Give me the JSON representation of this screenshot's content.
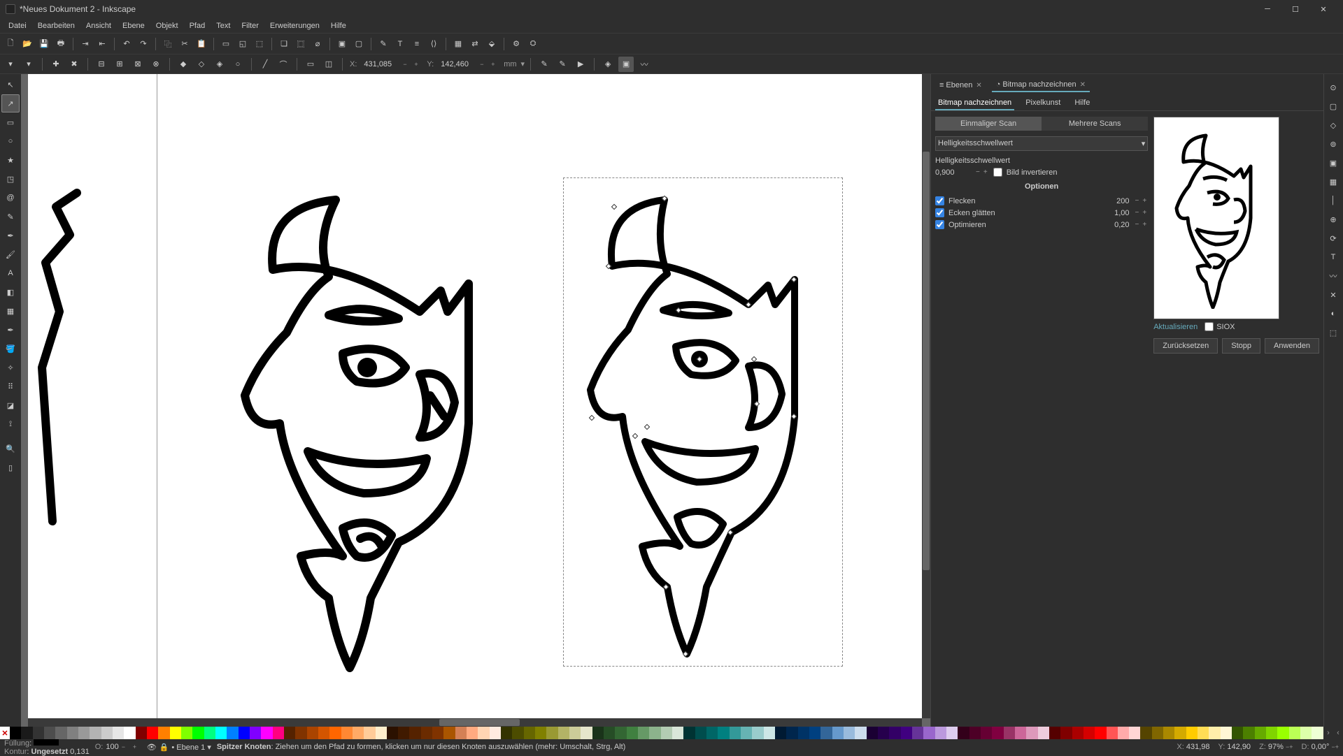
{
  "title": "*Neues Dokument 2 - Inkscape",
  "menus": [
    "Datei",
    "Bearbeiten",
    "Ansicht",
    "Ebene",
    "Objekt",
    "Pfad",
    "Text",
    "Filter",
    "Erweiterungen",
    "Hilfe"
  ],
  "coords": {
    "xlabel": "X:",
    "xval": "431,085",
    "ylabel": "Y:",
    "yval": "142,460",
    "unit": "mm"
  },
  "dialog": {
    "tab_layers": "Ebenen",
    "tab_trace": "Bitmap nachzeichnen",
    "sub_trace": "Bitmap nachzeichnen",
    "sub_pixel": "Pixelkunst",
    "sub_help": "Hilfe",
    "single": "Einmaliger Scan",
    "multi": "Mehrere Scans",
    "method": "Helligkeitsschwellwert",
    "method_label": "Helligkeitsschwellwert",
    "method_val": "0,900",
    "invert": "Bild invertieren",
    "options": "Optionen",
    "speckles": "Flecken",
    "speckles_val": "200",
    "smooth": "Ecken glätten",
    "smooth_val": "1,00",
    "optimize": "Optimieren",
    "optimize_val": "0,20",
    "update": "Aktualisieren",
    "siox": "SIOX",
    "reset": "Zurücksetzen",
    "stop": "Stopp",
    "apply": "Anwenden"
  },
  "status": {
    "fill": "Füllung",
    "stroke": "Kontur",
    "stroke_val": "Ungesetzt",
    "stroke_w": "0,131",
    "opacity_label": "O:",
    "opacity": "100",
    "layer": "Ebene 1",
    "hint_b": "Spitzer Knoten",
    "hint": ": Ziehen um den Pfad zu formen, klicken um nur diesen Knoten auszuwählen (mehr: Umschalt, Strg, Alt)",
    "xlabel": "X:",
    "x": "431,98",
    "ylabel": "Y:",
    "y": "142,90",
    "zlabel": "Z:",
    "z": "97%",
    "dlabel": "D:",
    "d": "0,00°"
  },
  "palette": [
    "#000",
    "#1a1a1a",
    "#333",
    "#4d4d4d",
    "#666",
    "#808080",
    "#999",
    "#b3b3b3",
    "#ccc",
    "#e6e6e6",
    "#fff",
    "#800000",
    "#f00",
    "#ff8000",
    "#ff0",
    "#80ff00",
    "#0f0",
    "#00ff80",
    "#0ff",
    "#0080ff",
    "#00f",
    "#8000ff",
    "#f0f",
    "#ff0080",
    "#552200",
    "#803300",
    "#aa4400",
    "#d45500",
    "#ff6600",
    "#ff8833",
    "#ffaa66",
    "#ffcc99",
    "#ffeecc",
    "#2b1100",
    "#401a00",
    "#552200",
    "#6b2b00",
    "#803300",
    "#aa5500",
    "#d48055",
    "#ffaa80",
    "#ffd5b3",
    "#ffebe0",
    "#333300",
    "#4c4c00",
    "#666600",
    "#808000",
    "#999933",
    "#b3b366",
    "#cccc99",
    "#e6e6cc",
    "#1a331a",
    "#264d26",
    "#336633",
    "#408040",
    "#669966",
    "#8cb38c",
    "#b3ccb3",
    "#d9e6d9",
    "#003333",
    "#004d4d",
    "#006666",
    "#008080",
    "#339999",
    "#66b3b3",
    "#99cccc",
    "#cce6e6",
    "#001a33",
    "#00264d",
    "#003366",
    "#004080",
    "#336699",
    "#6699cc",
    "#99bbdd",
    "#ccddee",
    "#1a0033",
    "#26004d",
    "#330066",
    "#400080",
    "#663399",
    "#9966cc",
    "#bb99dd",
    "#ddccee",
    "#33001a",
    "#4d0026",
    "#660033",
    "#800040",
    "#993366",
    "#cc6699",
    "#dd99bb",
    "#eeccdd",
    "#550000",
    "#800000",
    "#aa0000",
    "#d40000",
    "#ff0000",
    "#ff5555",
    "#ffaaaa",
    "#ffd5d5",
    "#554400",
    "#806600",
    "#aa8800",
    "#d4aa00",
    "#ffcc00",
    "#ffdd55",
    "#ffeeaa",
    "#fff6d5",
    "#335500",
    "#4c8000",
    "#66aa00",
    "#80d400",
    "#99ff00",
    "#bbff55",
    "#ddffaa",
    "#eeffd5"
  ]
}
